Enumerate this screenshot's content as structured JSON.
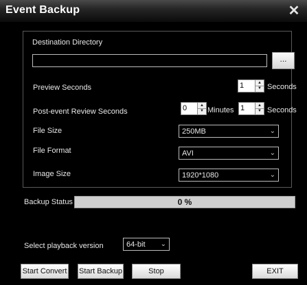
{
  "window": {
    "title": "Event Backup",
    "close_glyph": "✕"
  },
  "destination": {
    "label": "Destination Directory",
    "value": "",
    "browse_label": "..."
  },
  "preview": {
    "label": "Preview Seconds",
    "value": "1",
    "unit": "Seconds"
  },
  "post_event": {
    "label": "Post-event Review Seconds",
    "minutes_value": "0",
    "minutes_unit": "Minutes",
    "seconds_value": "1",
    "seconds_unit": "Seconds"
  },
  "file_size": {
    "label": "File Size",
    "selected": "250MB"
  },
  "file_format": {
    "label": "File Format",
    "selected": "AVI"
  },
  "image_size": {
    "label": "Image Size",
    "selected": "1920*1080"
  },
  "backup_status": {
    "label": "Backup Status",
    "progress_text": "0 %",
    "progress_fraction": 0
  },
  "playback_version": {
    "label": "Select playback version",
    "selected": "64-bit"
  },
  "buttons": {
    "start_convert": "Start Convert",
    "start_backup": "Start Backup",
    "stop": "Stop",
    "exit": "EXIT"
  },
  "icons": {
    "close": "close-icon",
    "spin_up": "chevron-up-icon",
    "spin_down": "chevron-down-icon",
    "dropdown": "chevron-down-icon"
  },
  "colors": {
    "background": "#000000",
    "progress_track": "#cfcfcf",
    "text": "#e8e8e8"
  }
}
